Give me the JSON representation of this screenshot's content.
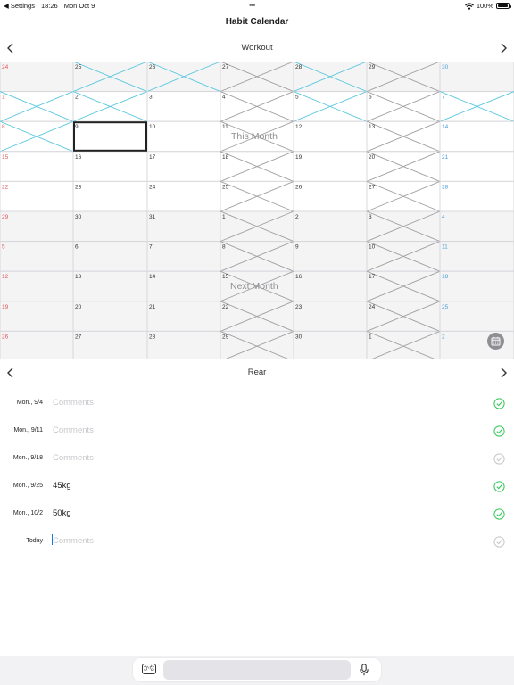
{
  "status_bar": {
    "back_label": "◀ Settings",
    "time": "18:26",
    "date": "Mon Oct 9",
    "battery": "100%"
  },
  "app_title": "Habit Calendar",
  "habit": {
    "name": "Workout"
  },
  "calendar": {
    "first_col_color": "#e0565b",
    "last_col_color": "#4a9fd9",
    "current_month_note": "This Month",
    "next_month_note": "Next Month",
    "rows": [
      [
        "24",
        "25",
        "26",
        "27",
        "28",
        "29",
        "30"
      ],
      [
        "1",
        "2",
        "3",
        "4",
        "5",
        "6",
        "7"
      ],
      [
        "8",
        "9",
        "10",
        "11",
        "12",
        "13",
        "14"
      ],
      [
        "15",
        "16",
        "17",
        "18",
        "19",
        "20",
        "21"
      ],
      [
        "22",
        "23",
        "24",
        "25",
        "26",
        "27",
        "28"
      ],
      [
        "29",
        "30",
        "31",
        "1",
        "2",
        "3",
        "4"
      ],
      [
        "5",
        "6",
        "7",
        "8",
        "9",
        "10",
        "11"
      ],
      [
        "12",
        "13",
        "14",
        "15",
        "16",
        "17",
        "18"
      ],
      [
        "19",
        "20",
        "21",
        "22",
        "23",
        "24",
        "25"
      ],
      [
        "26",
        "27",
        "28",
        "29",
        "30",
        "1",
        "2"
      ]
    ]
  },
  "sub_habit": {
    "name": "Rear"
  },
  "entries": [
    {
      "date": "Mon., 9/4",
      "comment": "",
      "done": true
    },
    {
      "date": "Mon., 9/11",
      "comment": "",
      "done": true
    },
    {
      "date": "Mon., 9/18",
      "comment": "",
      "done": false
    },
    {
      "date": "Mon., 9/25",
      "comment": "45kg",
      "done": true
    },
    {
      "date": "Mon., 10/2",
      "comment": "50kg",
      "done": true
    },
    {
      "date": "Today",
      "comment": "",
      "done": false,
      "editing": true
    }
  ],
  "comment_placeholder": "Comments",
  "keyboard": {
    "kana_label": "かな"
  },
  "colors": {
    "check_on": "#34c759",
    "check_off": "#c7c7cc",
    "blue_cross": "#5bc8de",
    "gray_cross": "#a0a0a0",
    "selected_border": "#222222"
  },
  "icons": [
    "chevron-left-icon",
    "chevron-right-icon",
    "calendar-icon",
    "check-circle-icon",
    "microphone-icon",
    "wifi-icon",
    "battery-icon"
  ]
}
